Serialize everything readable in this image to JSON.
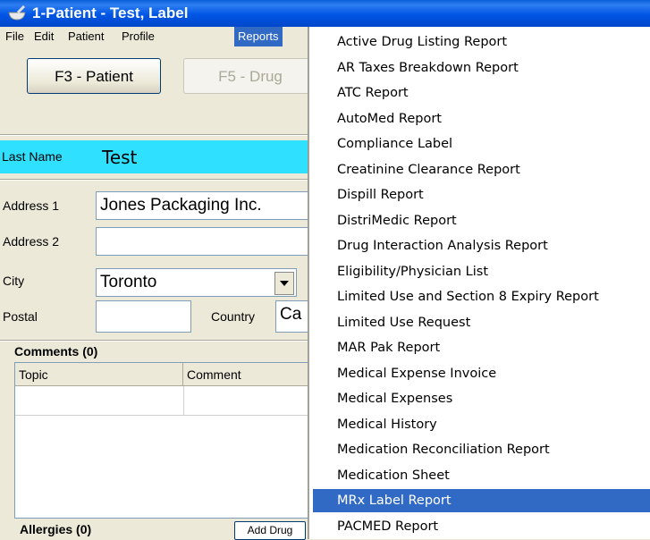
{
  "window": {
    "title": "1-Patient - Test, Label"
  },
  "menubar": {
    "items": [
      "File",
      "Edit",
      "Patient",
      "Profile",
      "Reports"
    ],
    "active": "Reports"
  },
  "toolbar": {
    "patient_button": "F3 - Patient",
    "drug_button": "F5 - Drug"
  },
  "form": {
    "last_name_label": "Last Name",
    "last_name_value": "Test",
    "address1_label": "Address 1",
    "address1_value": "Jones Packaging Inc.",
    "address2_label": "Address 2",
    "address2_value": "",
    "city_label": "City",
    "city_value": "Toronto",
    "postal_label": "Postal",
    "postal_value": "",
    "country_label": "Country",
    "country_value": "Ca"
  },
  "comments": {
    "header": "Comments (0)",
    "columns": [
      "Topic",
      "Comment"
    ]
  },
  "allergies": {
    "header": "Allergies (0)",
    "add_button": "Add Drug"
  },
  "reports_menu": {
    "items": [
      "Active Drug Listing Report",
      "AR Taxes Breakdown Report",
      "ATC Report",
      "AutoMed Report",
      "Compliance Label",
      "Creatinine Clearance Report",
      "Dispill Report",
      "DistriMedic Report",
      "Drug Interaction Analysis Report",
      "Eligibility/Physician List",
      "Limited Use and Section 8 Expiry Report",
      "Limited Use Request",
      "MAR Pak Report",
      "Medical Expense Invoice",
      "Medical Expenses",
      "Medical History",
      "Medication Reconciliation Report",
      "Medication Sheet",
      "MRx Label Report",
      "PACMED Report"
    ],
    "highlighted": "MRx Label Report"
  },
  "colors": {
    "titlebar": "#0055e5",
    "highlight": "#316ac5",
    "last_name_bg": "#30e0ff"
  },
  "icons": {
    "app": "mortar-pestle-icon",
    "combo": "chevron-down-icon"
  }
}
